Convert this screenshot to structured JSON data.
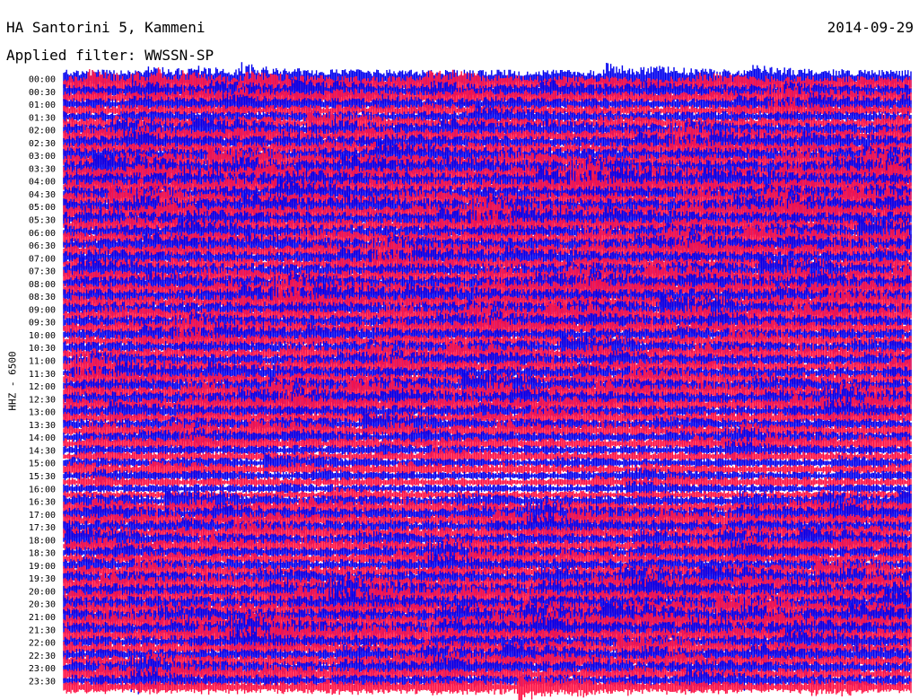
{
  "header": {
    "station": "HA Santorini 5, Kammeni",
    "filter": "Applied filter: WWSSN-SP",
    "date": "2014-09-29"
  },
  "chart_data": {
    "type": "line",
    "title": "HA Santorini 5, Kammeni",
    "date": "2014-09-29",
    "filter": "WWSSN-SP",
    "ylabel": "HHZ - 6500",
    "row_labels": [
      "00:00",
      "00:30",
      "01:00",
      "01:30",
      "02:00",
      "02:30",
      "03:00",
      "03:30",
      "04:00",
      "04:30",
      "05:00",
      "05:30",
      "06:00",
      "06:30",
      "07:00",
      "07:30",
      "08:00",
      "08:30",
      "09:00",
      "09:30",
      "10:00",
      "10:30",
      "11:00",
      "11:30",
      "12:00",
      "12:30",
      "13:00",
      "13:30",
      "14:00",
      "14:30",
      "15:00",
      "15:30",
      "16:00",
      "16:30",
      "17:00",
      "17:30",
      "18:00",
      "18:30",
      "19:00",
      "19:30",
      "20:00",
      "20:30",
      "21:00",
      "21:30",
      "22:00",
      "22:30",
      "23:00",
      "23:30"
    ],
    "row_minutes": 15,
    "series": [
      {
        "color": "#0000ee"
      },
      {
        "color": "#ff1144"
      }
    ],
    "relative_amplitude": [
      1.0,
      0.8,
      0.7,
      0.7,
      0.8,
      0.8,
      0.9,
      0.95,
      1.0,
      0.9,
      0.95,
      0.9,
      0.85,
      0.85,
      0.8,
      0.85,
      0.9,
      0.9,
      0.85,
      0.8,
      0.75,
      0.75,
      0.75,
      0.8,
      0.85,
      0.85,
      0.75,
      0.7,
      0.65,
      0.6,
      0.55,
      0.5,
      0.5,
      0.7,
      0.8,
      0.8,
      0.75,
      0.7,
      0.75,
      0.85,
      0.9,
      0.95,
      0.95,
      0.9,
      0.8,
      0.75,
      0.75,
      0.7
    ],
    "grid": false
  }
}
